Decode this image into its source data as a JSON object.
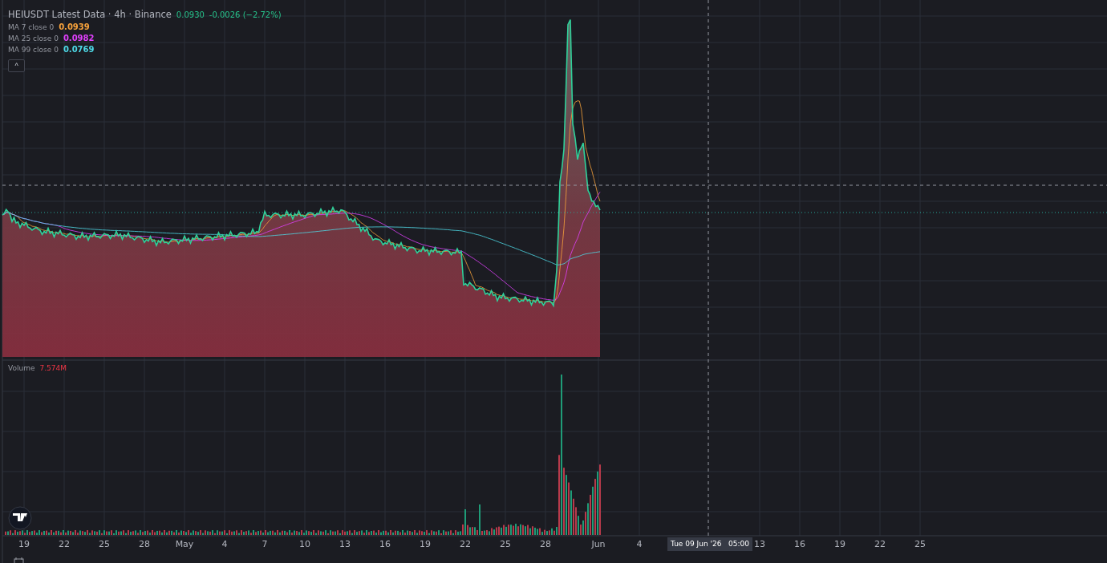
{
  "legend": {
    "title": "HEIUSDT Latest Data · 4h · Binance",
    "price": "0.0930",
    "change": "-0.0026 (−2.72%)"
  },
  "moving_averages": [
    {
      "label": "MA 7 close 0",
      "value": "0.0939",
      "color": "#f7a23b"
    },
    {
      "label": "MA 25 close 0",
      "value": "0.0982",
      "color": "#e040fb"
    },
    {
      "label": "MA 99 close 0",
      "value": "0.0769",
      "color": "#4dd9e6"
    }
  ],
  "collapse_button": {
    "symbol": "^"
  },
  "volume": {
    "label": "Volume",
    "value": "7.574M"
  },
  "x_axis": {
    "labels": [
      "19",
      "22",
      "25",
      "28",
      "May",
      "4",
      "7",
      "10",
      "13",
      "16",
      "19",
      "22",
      "25",
      "28",
      "Jun",
      "4",
      "13",
      "16",
      "19",
      "22",
      "25"
    ],
    "crosshair_label": "Tue 09 Jun '26   05:00"
  }
}
